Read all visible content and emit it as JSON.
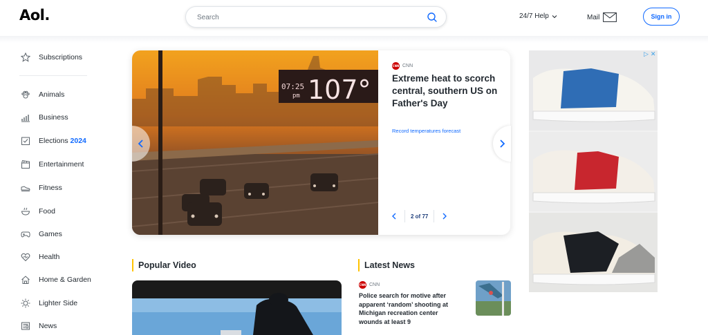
{
  "header": {
    "logo": "Aol.",
    "search_placeholder": "Search",
    "help_label": "24/7 Help",
    "mail_label": "Mail",
    "signin_label": "Sign in"
  },
  "sidebar": {
    "subscriptions": "Subscriptions",
    "items": [
      {
        "label": "Animals",
        "icon": "paw-icon"
      },
      {
        "label": "Business",
        "icon": "bar-chart-icon"
      },
      {
        "label": "Elections",
        "icon": "ballot-icon",
        "badge": "2024"
      },
      {
        "label": "Entertainment",
        "icon": "clapperboard-icon"
      },
      {
        "label": "Fitness",
        "icon": "sneaker-icon"
      },
      {
        "label": "Food",
        "icon": "bowl-icon"
      },
      {
        "label": "Games",
        "icon": "gamepad-icon"
      },
      {
        "label": "Health",
        "icon": "heart-pulse-icon"
      },
      {
        "label": "Home & Garden",
        "icon": "house-icon"
      },
      {
        "label": "Lighter Side",
        "icon": "sun-icon"
      },
      {
        "label": "News",
        "icon": "newspaper-icon"
      }
    ]
  },
  "hero": {
    "source": "CNN",
    "title": "Extreme heat to scorch central, southern US on Father's Day",
    "link": "Record temperatures forecast",
    "pager": "2 of 77",
    "sign_time": "07:25",
    "sign_ampm": "pm",
    "sign_temp": "107°"
  },
  "sections": {
    "popular_video": "Popular Video",
    "latest_news": "Latest News"
  },
  "latest_news": {
    "source": "CNN",
    "title": "Police search for motive after apparent ‘random’ shooting at Michigan recreation center wounds at least 9"
  },
  "colors": {
    "accent": "#0f69ff",
    "section_bar": "#ffc300",
    "cnn_red": "#cc0000"
  }
}
